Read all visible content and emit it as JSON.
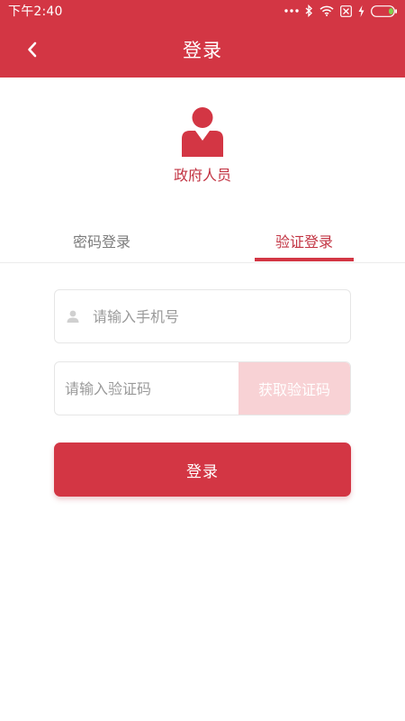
{
  "colors": {
    "primary": "#d33644",
    "primary_text": "#c23342",
    "button_disabled": "#f8d2d5",
    "inactive_tab": "#7b7b7b",
    "placeholder": "#9a9a9a"
  },
  "status_bar": {
    "time": "下午2:40",
    "icons": [
      "more-dots-icon",
      "bluetooth-icon",
      "wifi-icon",
      "sim-missing-icon",
      "charging-icon",
      "battery-icon"
    ]
  },
  "nav": {
    "back_icon": "chevron-left-icon",
    "title": "登录"
  },
  "profile": {
    "avatar_icon": "government-person-icon",
    "role": "政府人员"
  },
  "tabs": {
    "password_login": "密码登录",
    "sms_login": "验证登录",
    "active": "验证登录"
  },
  "form": {
    "phone": {
      "icon": "user-icon",
      "value": "",
      "placeholder": "请输入手机号"
    },
    "code": {
      "value": "",
      "placeholder": "请输入验证码"
    },
    "get_code_label": "获取验证码",
    "submit_label": "登录"
  }
}
